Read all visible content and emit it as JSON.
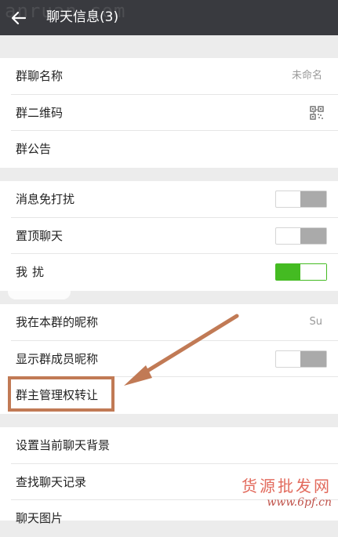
{
  "header": {
    "title": "聊天信息(3)"
  },
  "watermarks": {
    "top": "anruan.com",
    "bottom_cn": "货源批发网",
    "bottom_url": "www.6pf.cn"
  },
  "section1": {
    "group_name_label": "群聊名称",
    "group_name_value": "未命名",
    "qrcode_label": "群二维码",
    "notice_label": "群公告"
  },
  "section2": {
    "mute_label": "消息免打扰",
    "pin_label": "置顶聊天",
    "third_label": "我",
    "third_label_suffix": "扰",
    "mute_on": false,
    "pin_on": false,
    "third_on": true
  },
  "section3": {
    "nickname_label": "我在本群的昵称",
    "nickname_value": "Su",
    "show_nickname_label": "显示群成员昵称",
    "show_nickname_on": false,
    "transfer_label": "群主管理权转让"
  },
  "section4": {
    "background_label": "设置当前聊天背景",
    "search_label": "查找聊天记录",
    "images_label": "聊天图片"
  },
  "colors": {
    "titlebar": "#393a3f",
    "toggle_on": "#44bb22",
    "annotation": "#c17a55"
  }
}
